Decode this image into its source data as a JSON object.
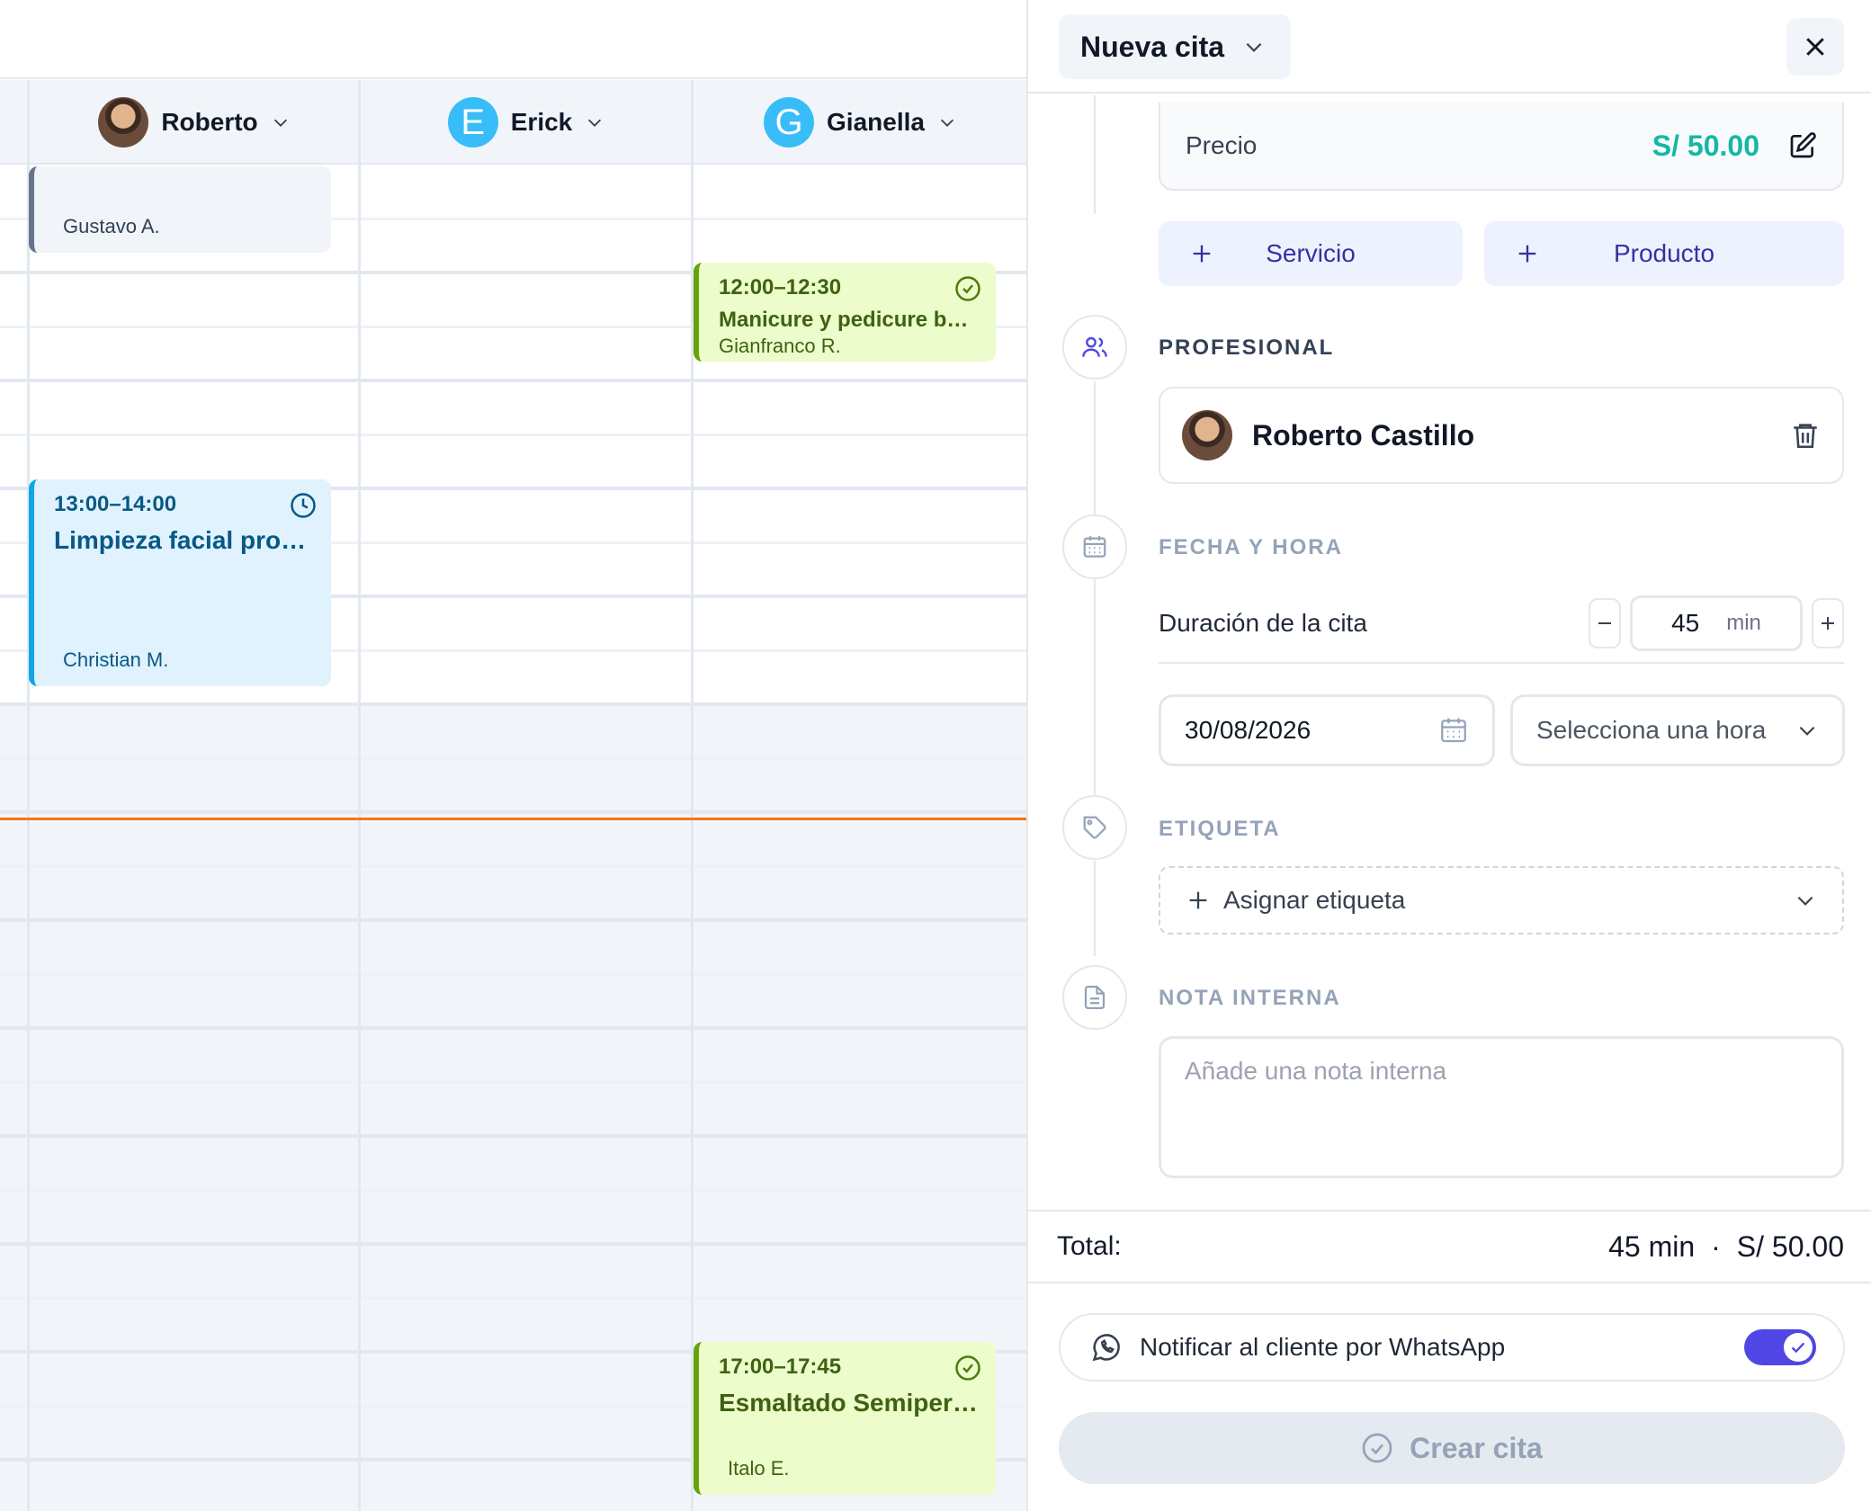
{
  "calendar": {
    "staff": [
      {
        "name": "Roberto",
        "initial": "",
        "color": "#6b4c3b"
      },
      {
        "name": "Erick",
        "initial": "E",
        "color": "#38bdf8"
      },
      {
        "name": "Gianella",
        "initial": "G",
        "color": "#38bdf8"
      }
    ],
    "events": [
      {
        "client": "Gustavo A."
      },
      {
        "time": "12:00–12:30",
        "title": "Manicure y pedicure bá…",
        "client": "Gianfranco R."
      },
      {
        "time": "13:00–14:00",
        "title": "Limpieza facial prof…",
        "client": "Christian M."
      },
      {
        "time": "17:00–17:45",
        "title": "Esmaltado Semiper…",
        "client": "Italo E."
      }
    ]
  },
  "panel": {
    "title": "Nueva cita",
    "precio": {
      "label": "Precio",
      "value": "S/ 50.00"
    },
    "add_service_label": "Servicio",
    "add_product_label": "Producto",
    "sections": {
      "profesional": "PROFESIONAL",
      "fecha_hora": "FECHA Y HORA",
      "etiqueta": "ETIQUETA",
      "nota": "NOTA INTERNA"
    },
    "professional_name": "Roberto Castillo",
    "duration": {
      "label": "Duración de la cita",
      "value": "45",
      "unit": "min"
    },
    "date_value": "30/08/2026",
    "time_placeholder": "Selecciona una hora",
    "tag_placeholder": "Asignar etiqueta",
    "note_placeholder": "Añade una nota interna",
    "total": {
      "label": "Total:",
      "duration": "45 min",
      "separator": "·",
      "price": "S/ 50.00"
    },
    "whatsapp": {
      "label": "Notificar al cliente por WhatsApp",
      "enabled": true
    },
    "create_label": "Crear cita"
  },
  "colors": {
    "accent": "#4f46e5",
    "price": "#14b8a6",
    "now_line": "#f97316"
  }
}
